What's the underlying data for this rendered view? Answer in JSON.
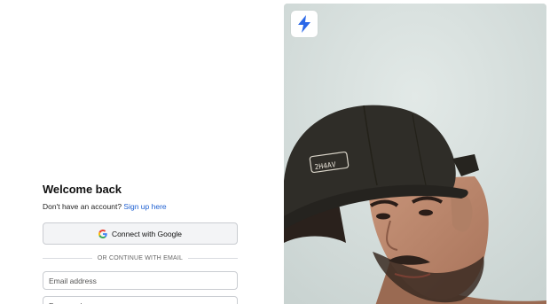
{
  "login": {
    "title": "Welcome back",
    "subtitle_text": "Don't have an account?",
    "signup_link": "Sign up here",
    "google_button_label": "Connect with Google",
    "divider_text": "OR CONTINUE WITH EMAIL",
    "email_placeholder": "Email address",
    "password_placeholder": "Password"
  },
  "hero": {
    "cap_text": "2H4AV",
    "logo_icon": "lightning-bolt-icon"
  },
  "colors": {
    "link": "#1d5fd1",
    "brand": "#2b68e8",
    "hero_bg": "#d7dfdd"
  }
}
